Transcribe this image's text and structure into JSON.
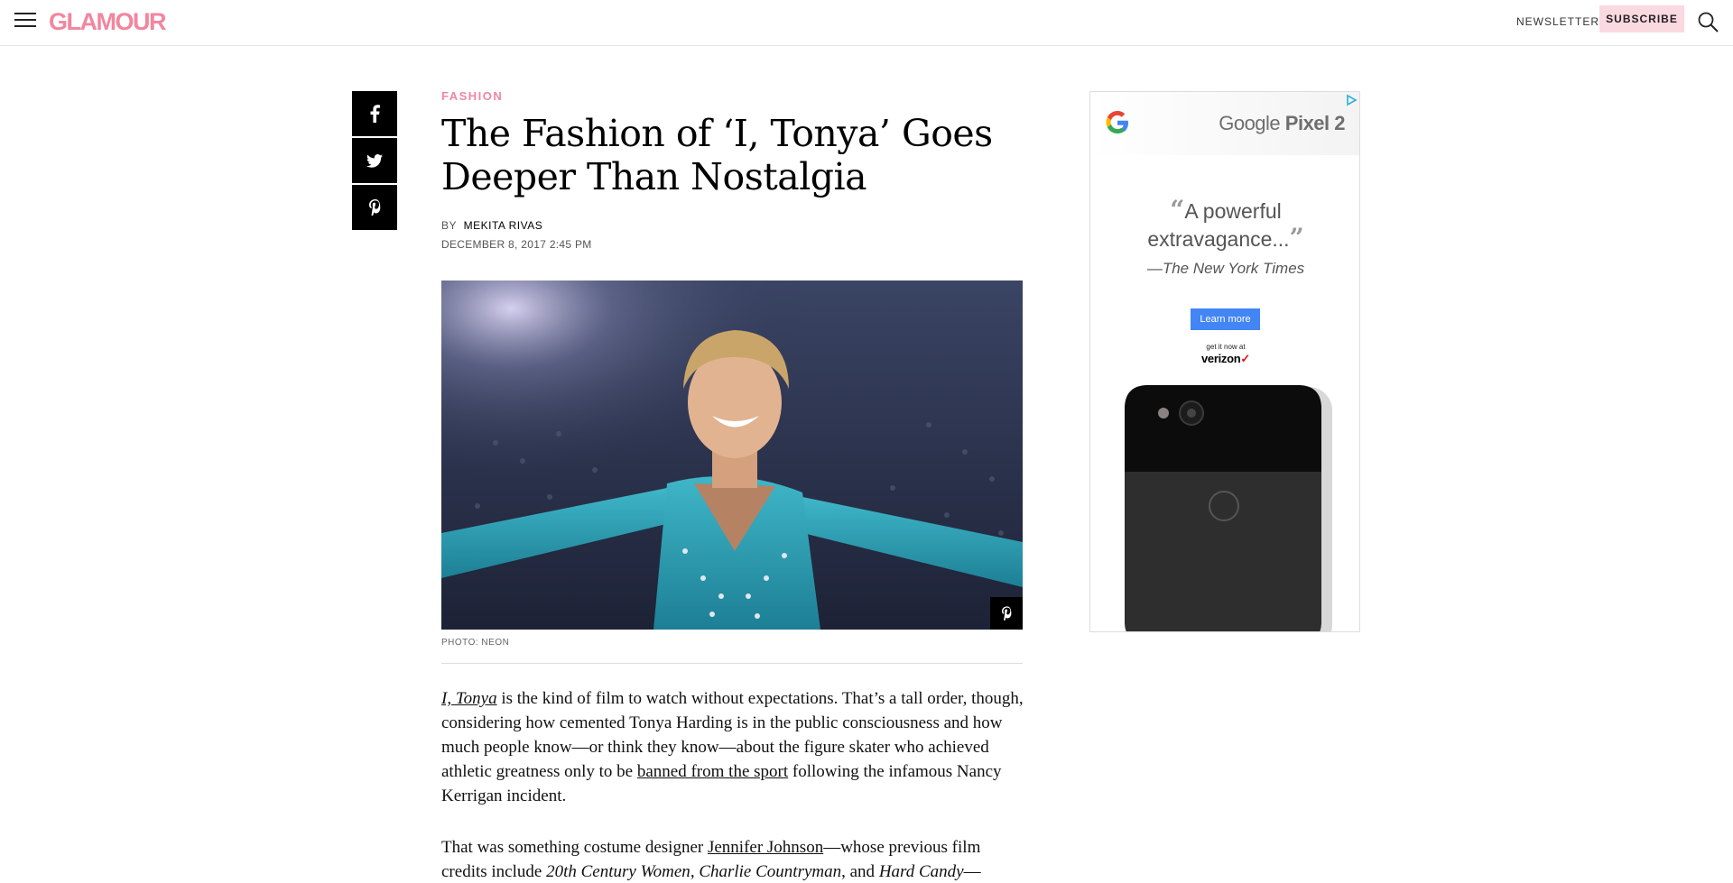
{
  "header": {
    "logo": "GLAMOUR",
    "newsletter_label": "NEWSLETTER",
    "subscribe_label": "SUBSCRIBE",
    "brand_color": "#f2869f",
    "subscribe_bg": "#fbd9e1"
  },
  "share": [
    {
      "network": "facebook",
      "icon": "facebook-icon"
    },
    {
      "network": "twitter",
      "icon": "twitter-icon"
    },
    {
      "network": "pinterest",
      "icon": "pinterest-icon"
    }
  ],
  "article": {
    "rubric": "FASHION",
    "headline": "The Fashion of ‘I, Tonya’ Goes Deeper Than Nostalgia",
    "by_label": "BY",
    "author": "MEKITA RIVAS",
    "date": "DECEMBER 8, 2017 2:45 PM",
    "photo_credit": "PHOTO: NEON",
    "p1": {
      "link1": "I, Tonya",
      "text1": " is the kind of film to watch without expectations. That’s a tall order, though, considering how cemented Tonya Harding is in the public consciousness and how much people know—or think they know—about the figure skater who achieved athletic greatness only to be ",
      "link2": "banned from the sport",
      "text2": " following the infamous Nancy Kerrigan incident."
    },
    "p2": {
      "text1": "That was something costume designer ",
      "link1": "Jennifer Johnson",
      "text2": "—whose previous film credits include ",
      "em1": "20th Century Women",
      "sep1": ", ",
      "em2": "Charlie Countryman",
      "sep2": ", and ",
      "em3": "Hard Candy",
      "text3": "—"
    }
  },
  "ad": {
    "brand_prefix": "Google ",
    "brand_bold": "Pixel 2",
    "quote": "A powerful extravagance...",
    "source": "—The New York Times",
    "cta": "Learn more",
    "get_it": "get it now at",
    "carrier": "verizon",
    "carrier_mark": "✓",
    "cta_color": "#4285f4"
  }
}
